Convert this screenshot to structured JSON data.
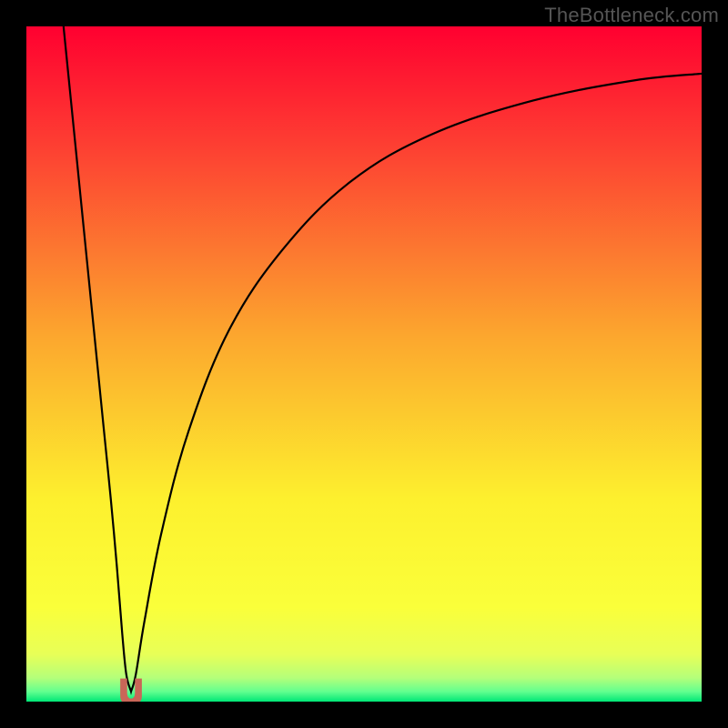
{
  "watermark": "TheBottleneck.com",
  "chart_data": {
    "type": "line",
    "title": "",
    "xlabel": "",
    "ylabel": "",
    "xlim": [
      0,
      100
    ],
    "ylim": [
      0,
      100
    ],
    "axes_visible": false,
    "background": {
      "type": "vertical-gradient",
      "stops": [
        {
          "pos": 0.0,
          "color": "#ff0030"
        },
        {
          "pos": 0.18,
          "color": "#fd4032"
        },
        {
          "pos": 0.46,
          "color": "#fca72e"
        },
        {
          "pos": 0.7,
          "color": "#fdf02e"
        },
        {
          "pos": 0.86,
          "color": "#faff3a"
        },
        {
          "pos": 0.93,
          "color": "#e8ff57"
        },
        {
          "pos": 0.965,
          "color": "#b4ff7a"
        },
        {
          "pos": 0.985,
          "color": "#63ff8f"
        },
        {
          "pos": 1.0,
          "color": "#00e776"
        }
      ]
    },
    "series": [
      {
        "name": "bottleneck-curve",
        "type": "line",
        "stroke": "#000000",
        "stroke_width": 2.2,
        "description": "V-shaped utilization curve dipping to ~0% near x≈15.5 (match point), rising steeply left of minimum and asymptotically toward ~93% on the right.",
        "minimum_x": 15.5,
        "minimum_y": 1.5,
        "points": [
          {
            "x": 5.5,
            "y": 100.0
          },
          {
            "x": 6.5,
            "y": 90.0
          },
          {
            "x": 7.5,
            "y": 80.0
          },
          {
            "x": 8.5,
            "y": 70.0
          },
          {
            "x": 9.5,
            "y": 60.0
          },
          {
            "x": 10.5,
            "y": 50.0
          },
          {
            "x": 11.5,
            "y": 40.0
          },
          {
            "x": 12.5,
            "y": 30.0
          },
          {
            "x": 13.4,
            "y": 20.0
          },
          {
            "x": 14.2,
            "y": 10.0
          },
          {
            "x": 14.8,
            "y": 4.0
          },
          {
            "x": 15.5,
            "y": 1.5
          },
          {
            "x": 16.2,
            "y": 4.0
          },
          {
            "x": 17.5,
            "y": 12.0
          },
          {
            "x": 20.0,
            "y": 25.0
          },
          {
            "x": 24.0,
            "y": 40.0
          },
          {
            "x": 30.0,
            "y": 55.0
          },
          {
            "x": 38.0,
            "y": 67.0
          },
          {
            "x": 48.0,
            "y": 77.0
          },
          {
            "x": 60.0,
            "y": 84.0
          },
          {
            "x": 75.0,
            "y": 89.0
          },
          {
            "x": 90.0,
            "y": 92.0
          },
          {
            "x": 100.0,
            "y": 93.0
          }
        ]
      },
      {
        "name": "match-marker",
        "type": "marker",
        "shape": "u-notch",
        "fill": "#c96658",
        "x": 15.5,
        "y": 1.5,
        "width": 3.2,
        "height": 3.5
      }
    ]
  }
}
